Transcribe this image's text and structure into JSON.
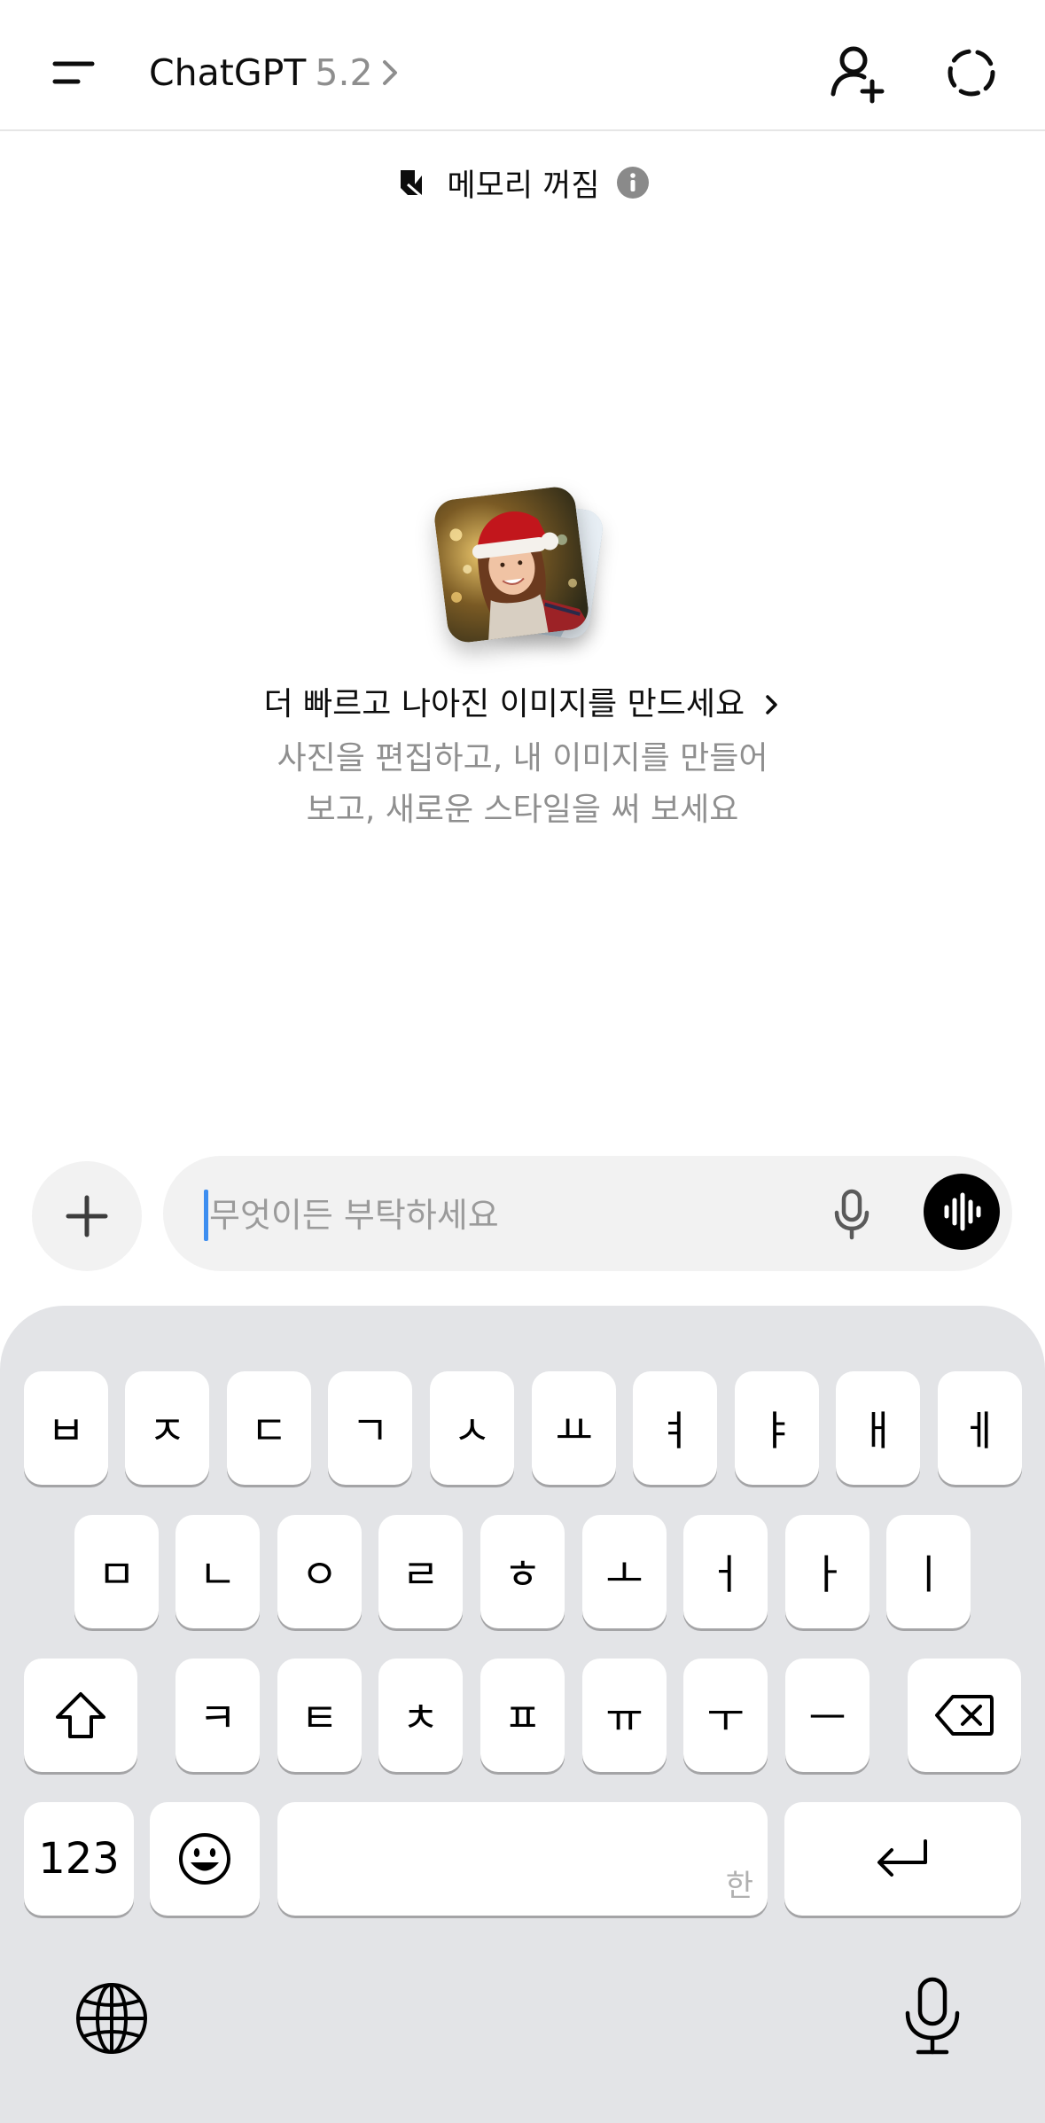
{
  "header": {
    "title": "ChatGPT",
    "version": "5.2"
  },
  "memory": {
    "label": "메모리 꺼짐"
  },
  "promo": {
    "title": "더 빠르고 나아진 이미지를 만드세요",
    "subtitle_line1": "사진을 편집하고, 내 이미지를 만들어",
    "subtitle_line2": "보고, 새로운 스타일을 써 보세요"
  },
  "composer": {
    "placeholder": "무엇이든 부탁하세요"
  },
  "keyboard": {
    "row1": [
      "ㅂ",
      "ㅈ",
      "ㄷ",
      "ㄱ",
      "ㅅ",
      "ㅛ",
      "ㅕ",
      "ㅑ",
      "ㅐ",
      "ㅔ"
    ],
    "row2": [
      "ㅁ",
      "ㄴ",
      "ㅇ",
      "ㄹ",
      "ㅎ",
      "ㅗ",
      "ㅓ",
      "ㅏ",
      "ㅣ"
    ],
    "row3": [
      "ㅋ",
      "ㅌ",
      "ㅊ",
      "ㅍ",
      "ㅠ",
      "ㅜ",
      "ㅡ"
    ],
    "numbers_label": "123",
    "space_hint": "한"
  },
  "icons": {
    "menu": "menu-icon",
    "add_user": "add-user-icon",
    "temp_chat": "temporary-chat-icon",
    "memory": "memory-off-icon",
    "info": "info-icon",
    "plus": "plus-icon",
    "mic": "microphone-icon",
    "voice": "voice-mode-icon",
    "shift": "shift-icon",
    "backspace": "backspace-icon",
    "emoji": "emoji-icon",
    "return": "return-icon",
    "globe": "globe-icon",
    "dictation": "dictation-mic-icon"
  },
  "colors": {
    "caret": "#3d8ef0",
    "keyboard_bg": "#e3e4e7",
    "secondary_text": "#8f8f8f"
  }
}
